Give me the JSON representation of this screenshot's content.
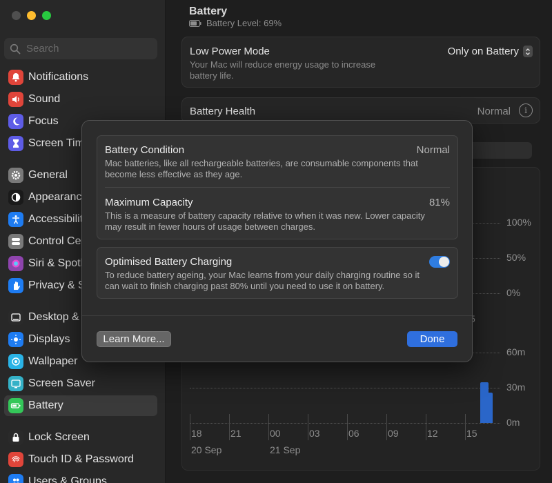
{
  "sidebar": {
    "search_placeholder": "Search",
    "items": [
      {
        "label": "Notifications",
        "icon": "bell-icon",
        "color": "#e0453a"
      },
      {
        "label": "Sound",
        "icon": "speaker-icon",
        "color": "#e0453a"
      },
      {
        "label": "Focus",
        "icon": "moon-icon",
        "color": "#5e5ce6"
      },
      {
        "label": "Screen Time",
        "icon": "hourglass-icon",
        "color": "#5e5ce6"
      },
      {
        "label": "General",
        "icon": "gear-icon",
        "color": "#7a7a7a"
      },
      {
        "label": "Appearance",
        "icon": "appearance-icon",
        "color": "#1a1a1a"
      },
      {
        "label": "Accessibility",
        "icon": "accessibility-icon",
        "color": "#1e7cf2"
      },
      {
        "label": "Control Centre",
        "icon": "control-centre-icon",
        "color": "#7a7a7a"
      },
      {
        "label": "Siri & Spotlight",
        "icon": "siri-icon",
        "color": "#8e44ad"
      },
      {
        "label": "Privacy & Security",
        "icon": "hand-icon",
        "color": "#1e7cf2"
      },
      {
        "label": "Desktop & Dock",
        "icon": "dock-icon",
        "color": "#2a2a2a"
      },
      {
        "label": "Displays",
        "icon": "sun-icon",
        "color": "#1e7cf2"
      },
      {
        "label": "Wallpaper",
        "icon": "wallpaper-icon",
        "color": "#2ab3e6"
      },
      {
        "label": "Screen Saver",
        "icon": "screen-saver-icon",
        "color": "#34b1c7"
      },
      {
        "label": "Battery",
        "icon": "battery-icon",
        "color": "#34c759"
      },
      {
        "label": "Lock Screen",
        "icon": "lock-icon",
        "color": "#2a2a2a"
      },
      {
        "label": "Touch ID & Password",
        "icon": "fingerprint-icon",
        "color": "#e0453a"
      },
      {
        "label": "Users & Groups",
        "icon": "users-icon",
        "color": "#1e7cf2"
      }
    ]
  },
  "header": {
    "title": "Battery",
    "battery_level": "Battery Level: 69%"
  },
  "low_power_mode": {
    "title": "Low Power Mode",
    "description": "Your Mac will reduce energy usage to increase battery life.",
    "value": "Only on Battery"
  },
  "battery_health": {
    "title": "Battery Health",
    "value": "Normal"
  },
  "chart": {
    "segment_partial": "s",
    "level_ticks": [
      "100%",
      "50%",
      "0%"
    ],
    "usage_ticks": [
      "60m",
      "30m",
      "0m"
    ],
    "hour_ticks": [
      "18",
      "21",
      "00",
      "03",
      "06",
      "09",
      "12",
      "15"
    ],
    "date_ticks": [
      "20 Sep",
      "21 Sep"
    ],
    "hidden_tick_partial": "5"
  },
  "chart_data": {
    "type": "bar",
    "categories": [
      "18",
      "21",
      "00",
      "03",
      "06",
      "09",
      "12",
      "15"
    ],
    "ylabel": "",
    "ylim": [
      0,
      60
    ],
    "series": [
      {
        "values": [
          0,
          0,
          0,
          0,
          0,
          0,
          0,
          0,
          0,
          0,
          0,
          0,
          0,
          0,
          0,
          0,
          0,
          0,
          0,
          0,
          0,
          0,
          0,
          0,
          0,
          0,
          0,
          0,
          0,
          0,
          0,
          0,
          0,
          0,
          0,
          0,
          0,
          0,
          0,
          0,
          0,
          0,
          0,
          0,
          0,
          0,
          0,
          0,
          0,
          0,
          0,
          0,
          0,
          0,
          0,
          0,
          0,
          0,
          0,
          0,
          0,
          0,
          0,
          0,
          0,
          0,
          0,
          0,
          0,
          0,
          35,
          26
        ]
      }
    ]
  },
  "modal": {
    "condition": {
      "title": "Battery Condition",
      "value": "Normal",
      "description": "Mac batteries, like all rechargeable batteries, are consumable components that become less effective as they age."
    },
    "capacity": {
      "title": "Maximum Capacity",
      "value": "81%",
      "description": "This is a measure of battery capacity relative to when it was new. Lower capacity may result in fewer hours of usage between charges."
    },
    "optimised": {
      "title": "Optimised Battery Charging",
      "enabled": true,
      "description": "To reduce battery ageing, your Mac learns from your daily charging routine so it can wait to finish charging past 80% until you need to use it on battery."
    },
    "learn_more_label": "Learn More...",
    "done_label": "Done"
  }
}
